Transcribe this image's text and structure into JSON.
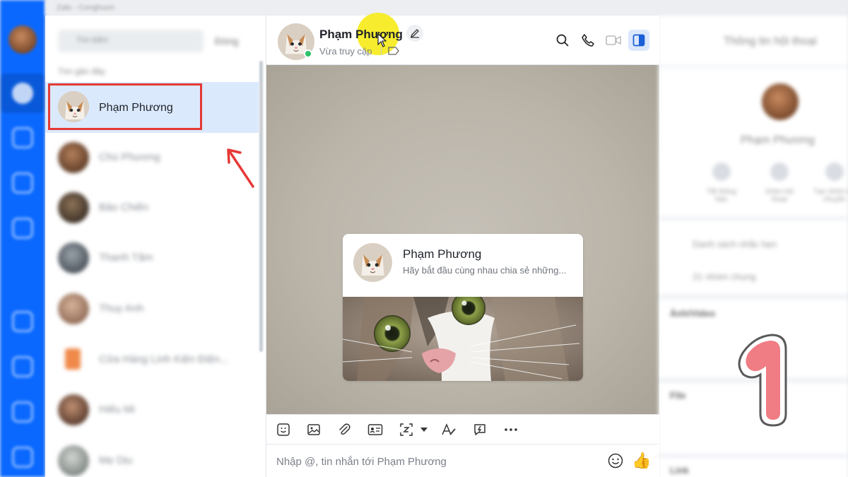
{
  "app": {
    "title": "Zalo - Conghuon"
  },
  "rail": {
    "items": [
      "messages",
      "contacts",
      "todo",
      "cloud",
      "screenshot",
      "briefcase",
      "settings"
    ]
  },
  "conversation_list": {
    "search_placeholder": "Tìm kiếm",
    "section_label": "Tìm gần đây",
    "filter_button": "Đóng",
    "items": [
      {
        "name": "Phạm Phương",
        "selected": true
      },
      {
        "name": "Chú Phương",
        "selected": false
      },
      {
        "name": "Bảo Chiến",
        "selected": false
      },
      {
        "name": "Thanh Tâm",
        "selected": false
      },
      {
        "name": "Thuy Anh",
        "selected": false
      },
      {
        "name": "Cửa Hàng Linh Kiện Điện...",
        "selected": false
      },
      {
        "name": "Hiếu Mi",
        "selected": false
      },
      {
        "name": "Mẹ Dịu",
        "selected": false
      }
    ]
  },
  "chat": {
    "contact_name": "Phạm Phương",
    "status": "Vừa truy cập",
    "online": true,
    "header_actions": [
      "search-icon",
      "phone-icon",
      "video-icon",
      "panel-toggle-icon"
    ],
    "card": {
      "title": "Phạm Phương",
      "subtitle": "Hãy bắt đầu cùng nhau chia sẻ những..."
    },
    "toolbar": [
      "sticker-icon",
      "image-icon",
      "attachment-icon",
      "contact-card-icon",
      "screenshot-icon",
      "dropdown-icon",
      "format-icon",
      "quick-message-icon",
      "more-icon"
    ],
    "input_placeholder": "Nhập @, tin nhắn tới Phạm Phương"
  },
  "info_panel": {
    "title": "Thông tin hội thoại",
    "name": "Phạm Phương",
    "actions": [
      "Tắt thông báo",
      "Ghim hội thoại",
      "Tạo nhóm trò chuyện"
    ],
    "rows": [
      "Danh sách nhắc hẹn",
      "21 nhóm chung"
    ],
    "sections": [
      "Ảnh/Video",
      "File",
      "Link"
    ]
  },
  "annotation": {
    "step_number": "1",
    "accent": "#e53935"
  }
}
